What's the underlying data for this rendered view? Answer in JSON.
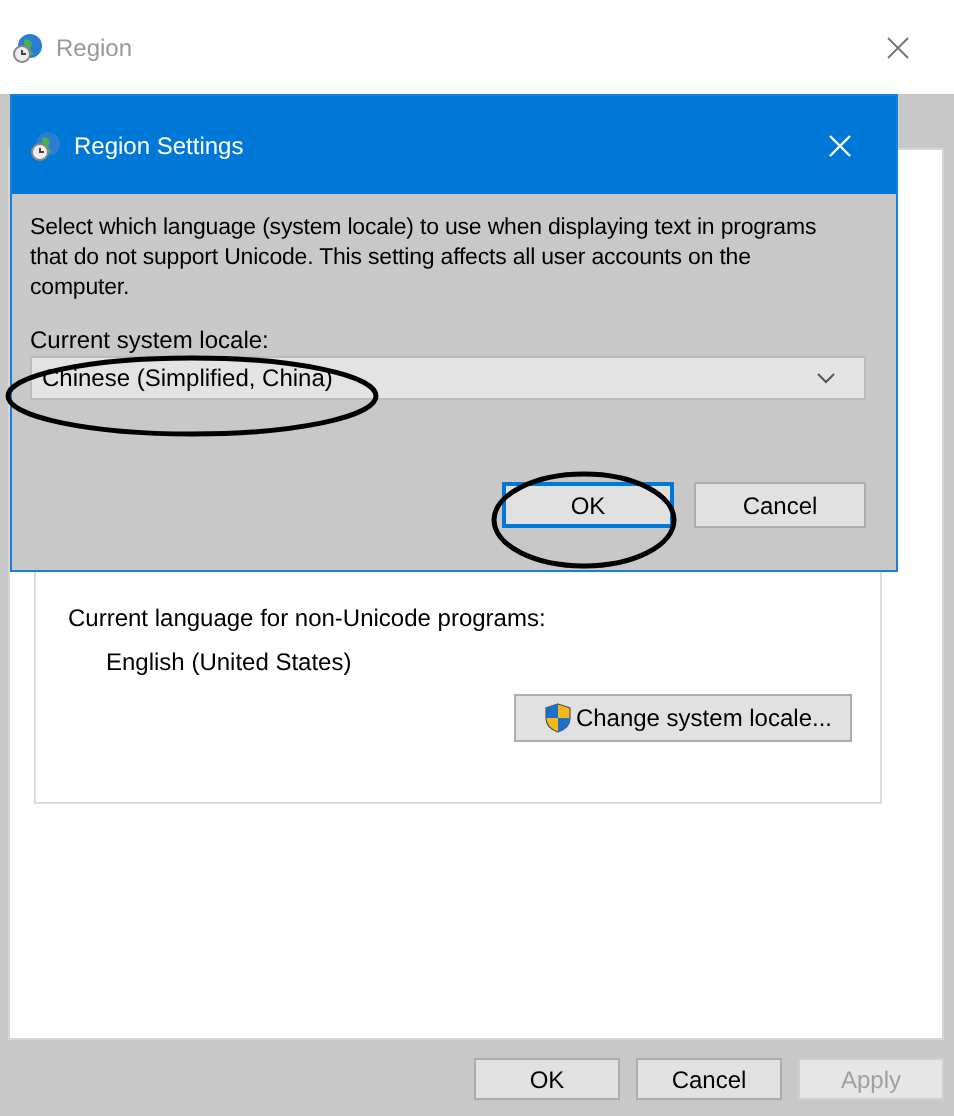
{
  "window": {
    "title": "Region"
  },
  "panel": {
    "label": "Current language for non-Unicode programs:",
    "value": "English (United States)",
    "button": "Change system locale..."
  },
  "buttons": [
    {
      "label": "OK",
      "disabled": false
    },
    {
      "label": "Cancel",
      "disabled": false
    },
    {
      "label": "Apply",
      "disabled": true
    }
  ],
  "dialog": {
    "title": "Region Settings",
    "description": "Select which language (system locale) to use when displaying text in programs that do not support Unicode. This setting affects all user accounts on the computer.",
    "field_label": "Current system locale:",
    "locale": "Chinese (Simplified, China)",
    "buttons": [
      {
        "label": "OK",
        "default": true
      },
      {
        "label": "Cancel",
        "default": false
      }
    ]
  }
}
